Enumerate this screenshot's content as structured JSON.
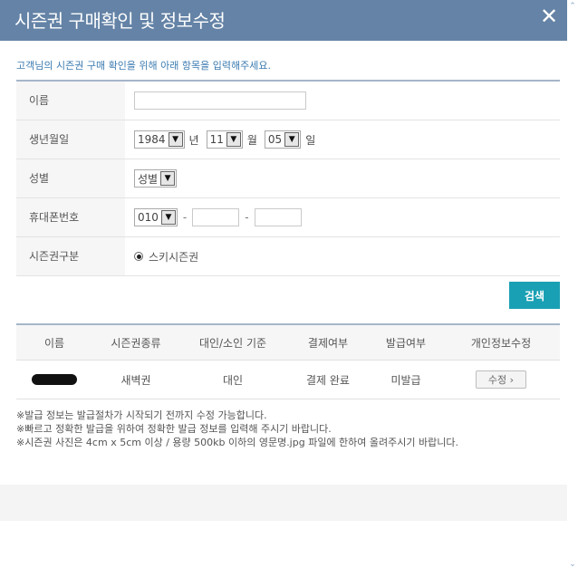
{
  "dialog": {
    "title": "시즌권 구매확인 및 정보수정",
    "close_icon": "close-icon",
    "close_symbol": "✕"
  },
  "intro": "고객님의 시즌권 구매 확인을 위해 아래 항목을 입력해주세요.",
  "form": {
    "name": {
      "label": "이름",
      "value": ""
    },
    "birth": {
      "label": "생년월일",
      "year": "1984",
      "year_unit": "년",
      "month": "11",
      "month_unit": "월",
      "day": "05",
      "day_unit": "일"
    },
    "gender": {
      "label": "성별",
      "selected": "성별"
    },
    "phone": {
      "label": "휴대폰번호",
      "prefix": "010",
      "dash": "-",
      "middle": "",
      "last": ""
    },
    "pass_type": {
      "label": "시즌권구분",
      "option": "스키시즌권"
    }
  },
  "search_button": "검색",
  "table": {
    "headers": [
      "이름",
      "시즌권종류",
      "대인/소인 기준",
      "결제여부",
      "발급여부",
      "개인정보수정"
    ],
    "row": {
      "pass_kind": "새벽권",
      "age_group": "대인",
      "payment": "결제 완료",
      "issue": "미발급",
      "edit_label": "수정 ›"
    }
  },
  "notes": [
    "※발급 정보는 발급절차가 시작되기 전까지 수정 가능합니다.",
    "※빠르고 정확한 발급을 위하여 정확한 발급 정보를 입력해 주시기 바랍니다.",
    "※시즌권 사진은 4cm x 5cm 이상 / 용량 500kb 이하의 영문명.jpg 파일에 한하여 올려주시기 바랍니다."
  ],
  "scroll": {
    "up": "⌃",
    "down": "⌄"
  },
  "colors": {
    "header": "#6483a6",
    "accent": "#1aa0b4",
    "intro_text": "#3c7bb0"
  }
}
